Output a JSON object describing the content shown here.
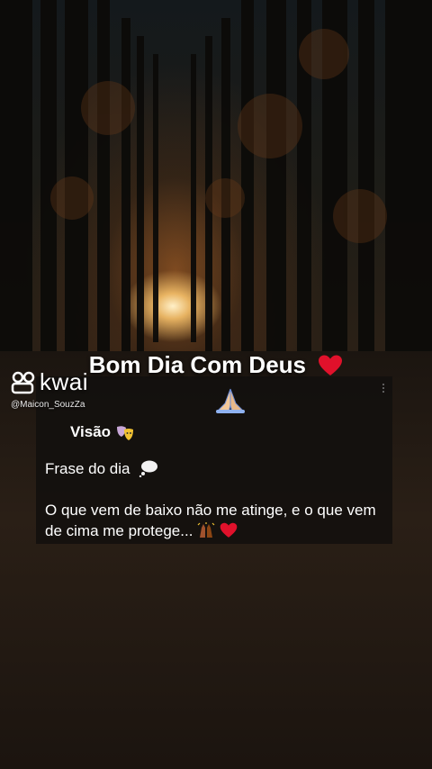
{
  "watermark": {
    "brand": "kwai",
    "handle": "@Maicon_SouzZa",
    "logo_icon": "kwai-logo-icon"
  },
  "caption": {
    "text": "Bom Dia Com Deus",
    "emoji_after": "red-heart-icon"
  },
  "card": {
    "praying_icon": "praying-hands-icon",
    "title": "Visão",
    "title_icon": "performing-arts-masks-icon",
    "frase_label": "Frase do dia",
    "frase_icon": "thought-bubble-icon",
    "quote_text": "O que vem de baixo não me atinge, e o que vem de cima me protege...",
    "quote_icons": [
      "raising-hands-icon",
      "red-heart-icon"
    ]
  },
  "colors": {
    "heart": "#e0112b",
    "card_bg": "#12100e",
    "text": "#ffffff"
  }
}
